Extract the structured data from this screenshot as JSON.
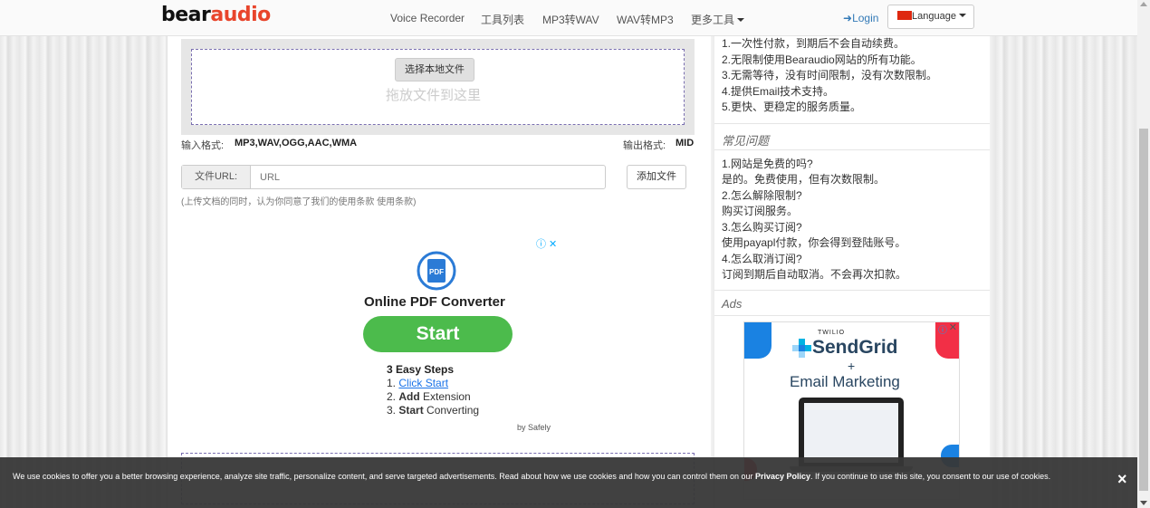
{
  "brand": {
    "part1": "bear",
    "part2": "audio"
  },
  "nav": {
    "items": [
      "Voice Recorder",
      "工具列表",
      "MP3转WAV",
      "WAV转MP3",
      "更多工具"
    ],
    "login": "Login",
    "language": "Language"
  },
  "upload": {
    "select_button": "选择本地文件",
    "drop_text": "拖放文件到这里",
    "input_format_label": "输入格式:",
    "input_formats": "MP3,WAV,OGG,AAC,WMA",
    "output_format_label": "输出格式:",
    "output_format": "MID",
    "url_addon": "文件URL:",
    "url_placeholder": "URL",
    "add_file_button": "添加文件",
    "terms_note": "(上传文档的同时，认为你同意了我们的使用条款 使用条款)"
  },
  "main_ad": {
    "heading": "Online PDF Converter",
    "cta": "Start",
    "pdf_badge": "PDF",
    "steps_title": "3 Easy Steps",
    "steps": [
      {
        "num": "1.",
        "bold": "",
        "link": "Click Start",
        "rest": ""
      },
      {
        "num": "2.",
        "bold": "Add",
        "link": "",
        "rest": "Extension"
      },
      {
        "num": "3.",
        "bold": "Start",
        "link": "",
        "rest": "Converting"
      }
    ],
    "by": "by Safely"
  },
  "sidebar": {
    "benefits": [
      "1.一次性付款，到期后不会自动续费。",
      "2.无限制使用Bearaudio网站的所有功能。",
      "3.无需等待，没有时间限制，没有次数限制。",
      "4.提供Email技术支持。",
      "5.更快、更稳定的服务质量。"
    ],
    "faq_title": "常见问题",
    "faq": [
      "1.网站是免费的吗?",
      "是的。免费使用，但有次数限制。",
      "2.怎么解除限制?",
      "购买订阅服务。",
      "3.怎么购买订阅?",
      "使用payapl付款，你会得到登陆账号。",
      "4.怎么取消订阅?",
      "订阅到期后自动取消。不会再次扣款。"
    ],
    "ads_title": "Ads",
    "ad": {
      "top": "TWILIO",
      "brand": "SendGrid",
      "plus": "+",
      "product": "Email Marketing"
    }
  },
  "cookie": {
    "text_before": "We use cookies to offer you a better browsing experience, analyze site traffic, personalize content, and serve targeted advertisements. Read about how we use cookies and how you can control them on our ",
    "link": "Privacy Policy",
    "text_after": ". If you continue to use this site, you consent to our use of cookies.",
    "close": "×"
  },
  "colors": {
    "accent": "#e8452c",
    "link": "#337ab7",
    "cta": "#4cbb4c",
    "cookie_bg": "#373737"
  }
}
